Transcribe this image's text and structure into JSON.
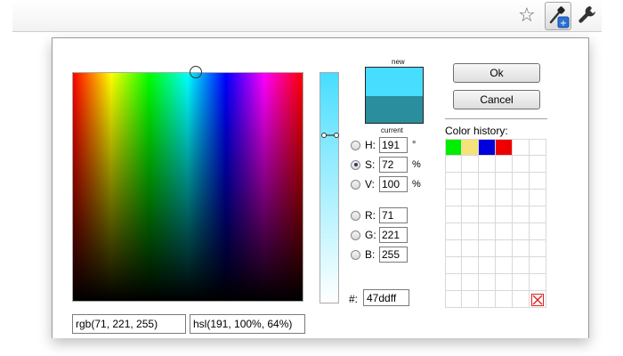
{
  "toolbar": {
    "icons": [
      "star-icon",
      "eyedropper-icon",
      "wrench-icon"
    ]
  },
  "picker": {
    "new_label": "new",
    "current_label": "current",
    "new_color": "#47ddff",
    "current_color": "#2a8e9e",
    "hue_color": "#00ccff",
    "fields": {
      "h": {
        "label": "H:",
        "value": "191",
        "unit": "°",
        "checked": false
      },
      "s": {
        "label": "S:",
        "value": "72",
        "unit": "%",
        "checked": true
      },
      "v": {
        "label": "V:",
        "value": "100",
        "unit": "%",
        "checked": false
      },
      "r": {
        "label": "R:",
        "value": "71",
        "checked": false
      },
      "g": {
        "label": "G:",
        "value": "221",
        "checked": false
      },
      "b": {
        "label": "B:",
        "value": "255",
        "checked": false
      }
    },
    "hex_label": "#:",
    "hex_value": "47ddff",
    "rgb_text": "rgb(71, 221, 255)",
    "hsl_text": "hsl(191, 100%, 64%)"
  },
  "buttons": {
    "ok_label": "Ok",
    "cancel_label": "Cancel"
  },
  "history": {
    "label": "Color history:",
    "colors": [
      "#00ee00",
      "#f5e27a",
      "#0000dd",
      "#ee0000"
    ]
  }
}
